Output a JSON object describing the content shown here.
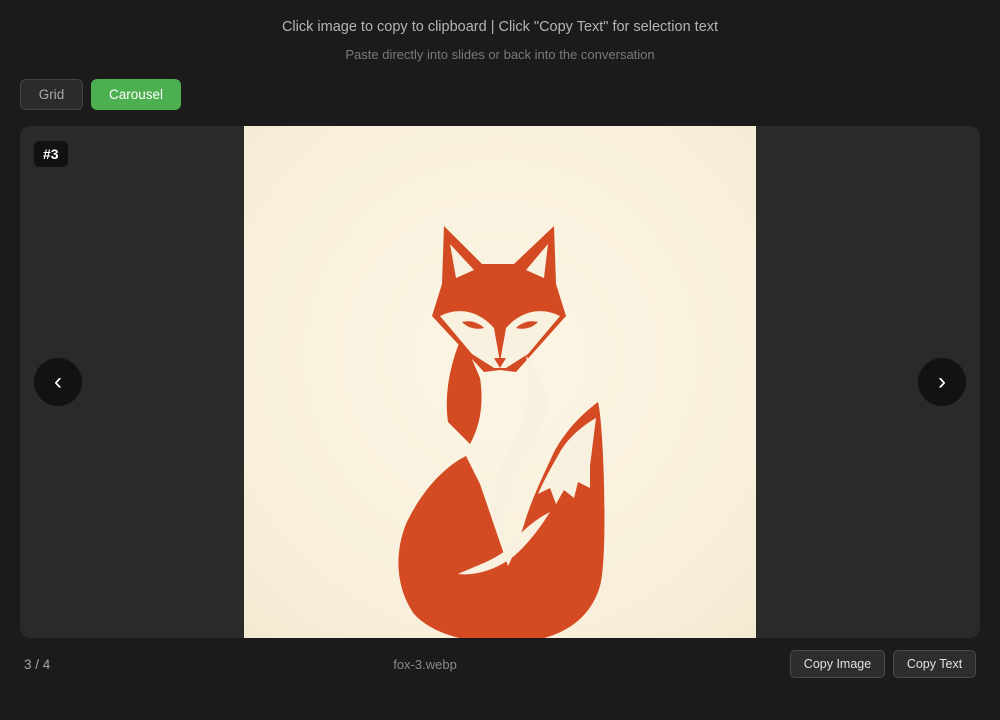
{
  "header": {
    "title": "Click image to copy to clipboard | Click \"Copy Text\" for selection text",
    "subtitle": "Paste directly into slides or back into the conversation"
  },
  "view_toggle": {
    "grid_label": "Grid",
    "carousel_label": "Carousel",
    "active": "Carousel"
  },
  "carousel": {
    "badge": "#3",
    "prev_label": "‹",
    "next_label": "›",
    "image_subject": "fox-logo",
    "counter": "3 / 4",
    "filename": "fox-3.webp"
  },
  "actions": {
    "copy_image_label": "Copy Image",
    "copy_text_label": "Copy Text"
  },
  "colors": {
    "background": "#1b1b1b",
    "accent": "#4caf50",
    "fox": "#d44a22",
    "image_bg": "#f8f0dc"
  }
}
